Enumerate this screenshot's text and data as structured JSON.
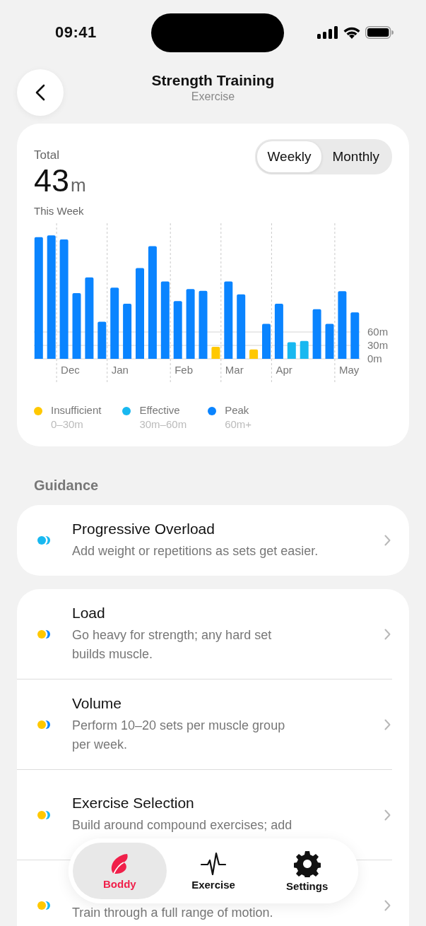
{
  "status_bar": {
    "time": "09:41"
  },
  "header": {
    "title": "Strength Training",
    "subtitle": "Exercise"
  },
  "summary": {
    "label": "Total",
    "value": "43",
    "unit": "m",
    "period": "This Week",
    "period_toggle": {
      "options": [
        {
          "label": "Weekly",
          "selected": true
        },
        {
          "label": "Monthly",
          "selected": false
        }
      ]
    },
    "chart_data": {
      "type": "bar",
      "categories": [
        null,
        null,
        "Dec",
        null,
        null,
        null,
        "Jan",
        null,
        null,
        null,
        null,
        "Feb",
        null,
        null,
        null,
        "Mar",
        null,
        null,
        null,
        "Apr",
        null,
        null,
        null,
        null,
        "May",
        null
      ],
      "series": [
        {
          "name": "Insufficient",
          "color": "#ffc800",
          "values": [
            null,
            null,
            null,
            null,
            null,
            null,
            null,
            null,
            null,
            null,
            null,
            null,
            null,
            null,
            27,
            null,
            null,
            21,
            null,
            null,
            null,
            null,
            null,
            null,
            null,
            null
          ]
        },
        {
          "name": "Effective",
          "color": "#18b8f0",
          "values": [
            null,
            null,
            null,
            null,
            null,
            null,
            null,
            null,
            null,
            null,
            null,
            null,
            null,
            null,
            null,
            null,
            null,
            null,
            null,
            null,
            37,
            40,
            null,
            null,
            null,
            null
          ]
        },
        {
          "name": "Peak",
          "color": "#0a84ff",
          "values": [
            272,
            276,
            267,
            147,
            182,
            83,
            159,
            123,
            203,
            252,
            173,
            129,
            156,
            152,
            null,
            173,
            144,
            null,
            78,
            123,
            null,
            null,
            111,
            78,
            151,
            104
          ]
        }
      ],
      "yticks": [
        {
          "value": 0,
          "label": "0m"
        },
        {
          "value": 30,
          "label": "30m"
        },
        {
          "value": 60,
          "label": "60m"
        }
      ],
      "ylim": [
        0,
        303
      ],
      "grid": true
    },
    "legend_ranges": [
      "0–30m",
      "30m–60m",
      "60m+"
    ]
  },
  "guidance": {
    "heading": "Guidance",
    "groups": [
      [
        {
          "title": "Progressive Overload",
          "description": "Add weight or repetitions as sets get easier.",
          "dots": [
            {
              "color": "#18b8f0"
            },
            {
              "color": "#18b8f0"
            }
          ]
        }
      ],
      [
        {
          "title": "Load",
          "description": "Go heavy for strength; any hard set builds muscle.",
          "dots": [
            {
              "color": "#ffc800"
            },
            {
              "color": "#0a84ff"
            }
          ]
        },
        {
          "title": "Volume",
          "description": "Perform 10–20 sets per muscle group per week.",
          "dots": [
            {
              "color": "#ffc800"
            },
            {
              "color": "#0a84ff"
            }
          ]
        },
        {
          "title": "Exercise Selection",
          "description": "Build around compound exercises; add",
          "dots": [
            {
              "color": "#ffc800"
            },
            {
              "color": "#18b8f0"
            }
          ]
        },
        {
          "description": "Train through a full range of motion.",
          "dots": [
            {
              "color": "#ffc800"
            },
            {
              "color": "#18b8f0"
            }
          ]
        }
      ]
    ]
  },
  "tab_bar": {
    "tabs": [
      {
        "label": "Boddy",
        "kind": "leaf",
        "selected": true
      },
      {
        "label": "Exercise",
        "kind": "pulse",
        "selected": false
      },
      {
        "label": "Settings",
        "kind": "gear",
        "selected": false
      }
    ]
  }
}
